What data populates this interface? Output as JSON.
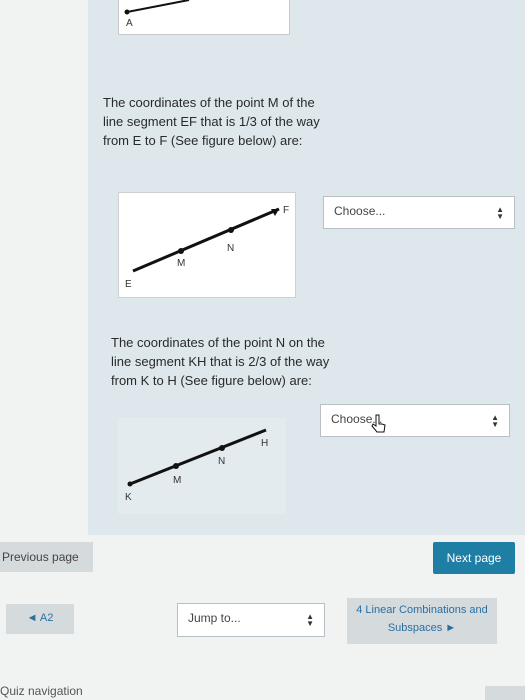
{
  "previous_figure": {
    "point_label": "A"
  },
  "question1": {
    "text": "The coordinates of the point M of the line segment EF that is 1/3 of the way from E to F (See figure below) are:",
    "figure_labels": {
      "start": "E",
      "first": "M",
      "second": "N",
      "end": "F"
    },
    "select_value": "Choose..."
  },
  "question2": {
    "text": "The coordinates of the point N on the line segment KH that is 2/3 of the way from K to H (See figure below) are:",
    "figure_labels": {
      "start": "K",
      "first": "M",
      "second": "N",
      "end": "H"
    },
    "select_value": "Choose..."
  },
  "navigation": {
    "previous_label": "Previous page",
    "next_label": "Next page",
    "back_link": "◄ A2",
    "jump_placeholder": "Jump to...",
    "forward_link": "4 Linear Combinations and Subspaces ►",
    "quiz_navigation": "Quiz navigation"
  },
  "icons": {
    "select_arrows": "up-down-arrows-icon",
    "cursor": "pointer-cursor-icon"
  },
  "colors": {
    "next_button": "#1f7ea4",
    "panel": "#dde7ec",
    "link": "#2a6fa1"
  }
}
